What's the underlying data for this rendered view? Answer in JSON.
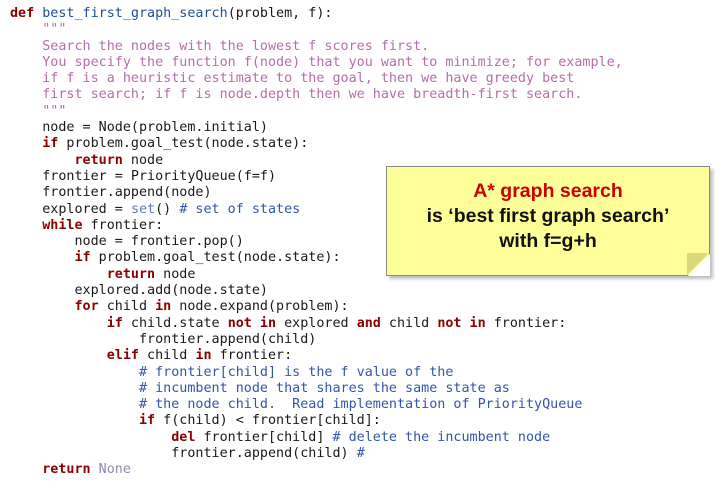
{
  "code": {
    "l1": {
      "def": "def",
      "name": "best_first_graph_search",
      "rest": "(problem, f):"
    },
    "l2": "\"\"\"",
    "l3": "Search the nodes with the lowest f scores first.",
    "l4": "You specify the function f(node) that you want to minimize; for example,",
    "l5": "if f is a heuristic estimate to the goal, then we have greedy best",
    "l6": "first search; if f is node.depth then we have breadth-first search.",
    "l7": "\"\"\"",
    "l8": "node = Node(problem.initial)",
    "l9": {
      "kw": "if",
      "rest": " problem.goal_test(node.state):"
    },
    "l10": {
      "kw": "return",
      "rest": " node"
    },
    "l11": "frontier = PriorityQueue(f=f)",
    "l12": "frontier.append(node)",
    "l13": {
      "a": "explored = ",
      "bi": "set",
      "b": "() ",
      "cm": "# set of states"
    },
    "l14": {
      "kw": "while",
      "rest": " frontier:"
    },
    "l15": "node = frontier.pop()",
    "l16": {
      "kw": "if",
      "rest": " problem.goal_test(node.state):"
    },
    "l17": {
      "kw": "return",
      "rest": " node"
    },
    "l18": "explored.add(node.state)",
    "l19": {
      "kw1": "for",
      "a": " child ",
      "kw2": "in",
      "b": " node.expand(problem):"
    },
    "l20": {
      "kw1": "if",
      "a": " child.state ",
      "kw2": "not in",
      "b": " explored ",
      "kw3": "and",
      "c": " child ",
      "kw4": "not in",
      "d": " frontier:"
    },
    "l21": "frontier.append(child)",
    "l22": {
      "kw1": "elif",
      "a": " child ",
      "kw2": "in",
      "b": " frontier:"
    },
    "l23": "# frontier[child] is the f value of the",
    "l24": "# incumbent node that shares the same state as",
    "l25": "# the node child.  Read implementation of PriorityQueue",
    "l26": {
      "kw": "if",
      "rest": " f(child) < frontier[child]:"
    },
    "l27": {
      "kw": "del",
      "a": " frontier[child] ",
      "cm": "# delete the incumbent node"
    },
    "l28": {
      "a": "frontier.append(child) ",
      "cm": "#"
    },
    "l29": {
      "kw": "return",
      "cn": " None"
    }
  },
  "note": {
    "title": "A* graph search",
    "line1": "is ‘best first graph search’",
    "line2": "with f=g+h"
  }
}
